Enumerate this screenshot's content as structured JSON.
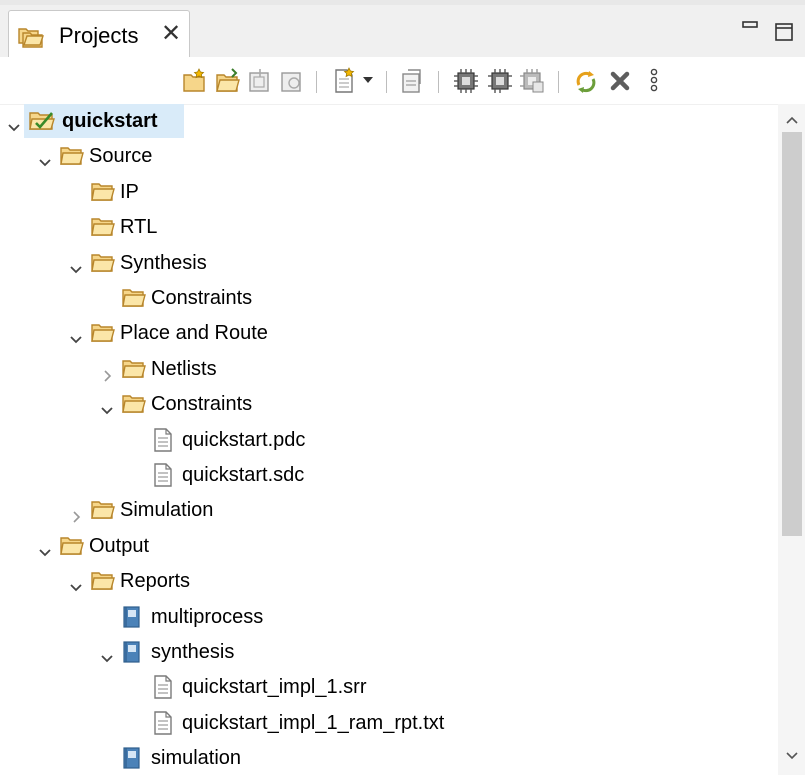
{
  "panel": {
    "tab_label": "Projects",
    "tab_close": "✕",
    "minimize_label": "Minimize",
    "maximize_label": "Maximize"
  },
  "toolbar": {
    "buttons": [
      {
        "name": "new-file-icon"
      },
      {
        "name": "open-folder-icon"
      },
      {
        "name": "import-icon"
      },
      {
        "name": "export-icon"
      },
      {
        "name": "add-source-icon"
      },
      {
        "name": "dropdown-icon"
      },
      {
        "name": "properties-icon"
      },
      {
        "name": "chip-icon"
      },
      {
        "name": "chip-run-icon"
      },
      {
        "name": "chip-save-icon"
      },
      {
        "name": "refresh-icon"
      },
      {
        "name": "delete-icon"
      },
      {
        "name": "more-icon"
      }
    ]
  },
  "tree": {
    "items": [
      {
        "label": "quickstart",
        "level": 0,
        "expand": "open",
        "icon": "project",
        "bold": true,
        "selected": true
      },
      {
        "label": "Source",
        "level": 1,
        "expand": "open",
        "icon": "folder"
      },
      {
        "label": "IP",
        "level": 2,
        "expand": "none",
        "icon": "folder"
      },
      {
        "label": "RTL",
        "level": 2,
        "expand": "none",
        "icon": "folder"
      },
      {
        "label": "Synthesis",
        "level": 2,
        "expand": "open",
        "icon": "folder"
      },
      {
        "label": "Constraints",
        "level": 3,
        "expand": "none",
        "icon": "folder"
      },
      {
        "label": "Place and Route",
        "level": 2,
        "expand": "open",
        "icon": "folder"
      },
      {
        "label": "Netlists",
        "level": 3,
        "expand": "closed",
        "icon": "folder"
      },
      {
        "label": "Constraints",
        "level": 3,
        "expand": "open",
        "icon": "folder"
      },
      {
        "label": "quickstart.pdc",
        "level": 4,
        "expand": "none",
        "icon": "file"
      },
      {
        "label": "quickstart.sdc",
        "level": 4,
        "expand": "none",
        "icon": "file"
      },
      {
        "label": "Simulation",
        "level": 2,
        "expand": "closed",
        "icon": "folder"
      },
      {
        "label": "Output",
        "level": 1,
        "expand": "open",
        "icon": "folder"
      },
      {
        "label": "Reports",
        "level": 2,
        "expand": "open",
        "icon": "folder"
      },
      {
        "label": "multiprocess",
        "level": 3,
        "expand": "none",
        "icon": "book"
      },
      {
        "label": "synthesis",
        "level": 3,
        "expand": "open",
        "icon": "book"
      },
      {
        "label": "quickstart_impl_1.srr",
        "level": 4,
        "expand": "none",
        "icon": "file"
      },
      {
        "label": "quickstart_impl_1_ram_rpt.txt",
        "level": 4,
        "expand": "none",
        "icon": "file"
      },
      {
        "label": "simulation",
        "level": 3,
        "expand": "none",
        "icon": "book"
      }
    ]
  },
  "colors": {
    "selection": "#d9ebf9",
    "folder_fill": "#f6d68a",
    "folder_stroke": "#b8862b",
    "book_fill": "#4b82b8"
  }
}
